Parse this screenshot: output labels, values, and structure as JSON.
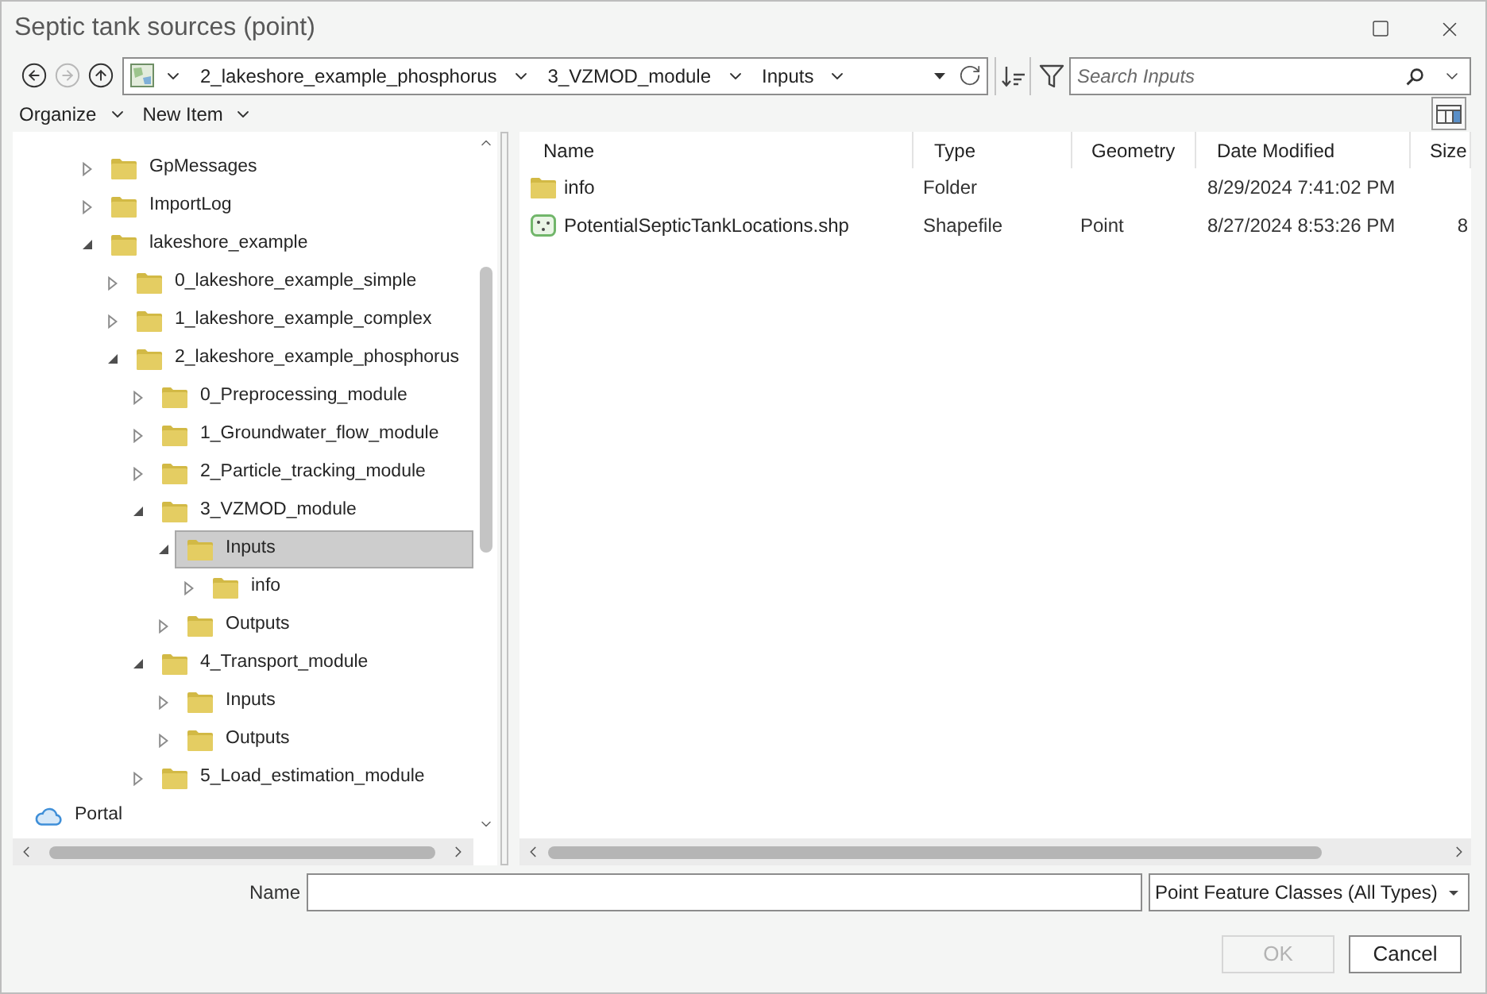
{
  "window": {
    "title": "Septic tank sources (point)"
  },
  "nav_buttons": [
    {
      "kind": "back",
      "disabled": false
    },
    {
      "kind": "forward",
      "disabled": true
    },
    {
      "kind": "up",
      "disabled": false
    }
  ],
  "breadcrumb": [
    "2_lakeshore_example_phosphorus",
    "3_VZMOD_module",
    "Inputs"
  ],
  "search": {
    "placeholder": "Search Inputs"
  },
  "toolbar": {
    "menus": [
      "Organize",
      "New Item"
    ]
  },
  "tree": {
    "items": [
      {
        "label": "GpMessages",
        "expanded": false,
        "selected": false
      },
      {
        "label": "ImportLog",
        "expanded": false,
        "selected": false
      },
      {
        "label": "lakeshore_example",
        "expanded": true,
        "selected": false,
        "children": [
          {
            "label": "0_lakeshore_example_simple",
            "expanded": false,
            "selected": false
          },
          {
            "label": "1_lakeshore_example_complex",
            "expanded": false,
            "selected": false
          },
          {
            "label": "2_lakeshore_example_phosphorus",
            "expanded": true,
            "selected": false,
            "children": [
              {
                "label": "0_Preprocessing_module",
                "expanded": false,
                "selected": false
              },
              {
                "label": "1_Groundwater_flow_module",
                "expanded": false,
                "selected": false
              },
              {
                "label": "2_Particle_tracking_module",
                "expanded": false,
                "selected": false
              },
              {
                "label": "3_VZMOD_module",
                "expanded": true,
                "selected": false,
                "children": [
                  {
                    "label": "Inputs",
                    "expanded": true,
                    "selected": true,
                    "children": [
                      {
                        "label": "info",
                        "expanded": false,
                        "selected": false
                      }
                    ]
                  },
                  {
                    "label": "Outputs",
                    "expanded": false,
                    "selected": false
                  }
                ]
              },
              {
                "label": "4_Transport_module",
                "expanded": true,
                "selected": false,
                "children": [
                  {
                    "label": "Inputs",
                    "expanded": false,
                    "selected": false
                  },
                  {
                    "label": "Outputs",
                    "expanded": false,
                    "selected": false
                  }
                ]
              },
              {
                "label": "5_Load_estimation_module",
                "expanded": false,
                "selected": false
              }
            ]
          }
        ]
      }
    ],
    "portal": {
      "label": "Portal"
    }
  },
  "file_list": {
    "columns": [
      "Name",
      "Type",
      "Geometry",
      "Date Modified",
      "Size"
    ],
    "rows": [
      {
        "kind": "folder",
        "selected": false,
        "name": "info",
        "type": "Folder",
        "date_modified": "8/29/2024 7:41:02 PM"
      },
      {
        "kind": "shapefile",
        "selected": false,
        "name": "PotentialSepticTankLocations.shp",
        "type": "Shapefile",
        "geometry": "Point",
        "date_modified": "8/27/2024 8:53:26 PM",
        "size": "8"
      }
    ]
  },
  "name_field": {
    "label": "Name"
  },
  "type_filter": {
    "value": "Point Feature Classes (All Types)"
  },
  "buttons": [
    {
      "label": "OK",
      "disabled": true
    },
    {
      "label": "Cancel",
      "disabled": false
    }
  ]
}
